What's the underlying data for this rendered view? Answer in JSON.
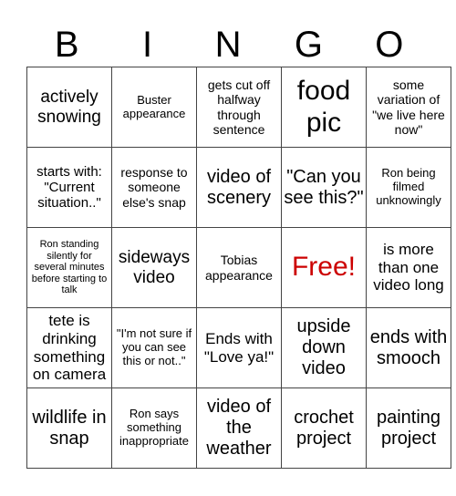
{
  "header": [
    "B",
    "I",
    "N",
    "G",
    "O"
  ],
  "board": [
    [
      "actively snowing",
      "Buster appearance",
      "gets cut off halfway through sentence",
      "food pic",
      "some variation of \"we live here now\""
    ],
    [
      "starts with: \"Current situation..\"",
      "response to someone else's snap",
      "video of scenery",
      "\"Can you see this?\"",
      "Ron being filmed unknowingly"
    ],
    [
      "Ron standing silently for several minutes before starting to talk",
      "sideways video",
      "Tobias appearance",
      "Free!",
      "is more than one video long"
    ],
    [
      "tete is drinking something on camera",
      "\"I'm not sure if you can see this or not..\"",
      "Ends with \"Love ya!\"",
      "upside down video",
      "ends with smooch"
    ],
    [
      "wildlife in snap",
      "Ron says something inappropriate",
      "video of the weather",
      "crochet project",
      "painting project"
    ]
  ],
  "free_color": "#cc0000"
}
